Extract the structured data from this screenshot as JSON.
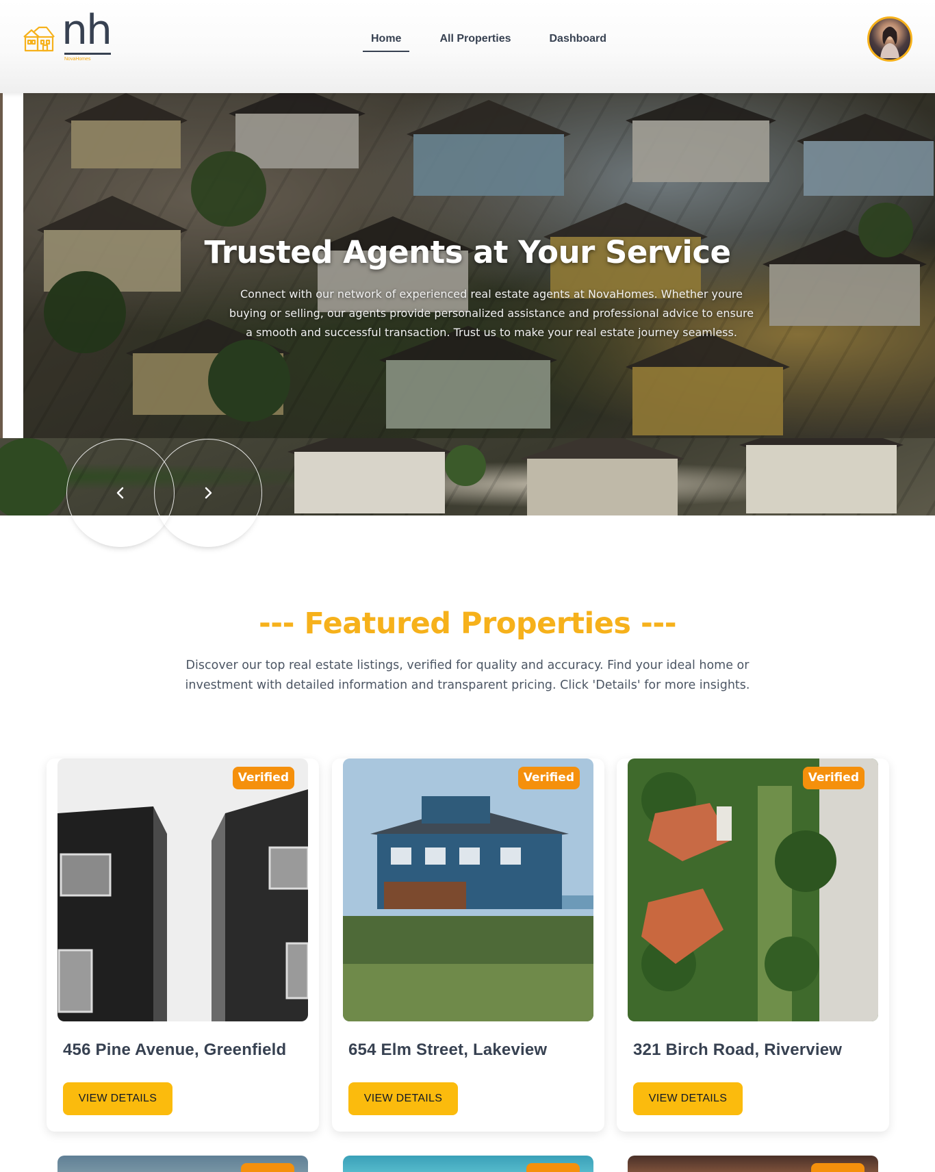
{
  "brand": {
    "logo_text": "nh",
    "logo_subtitle": "NovaHomes"
  },
  "nav": {
    "items": [
      {
        "label": "Home",
        "active": true
      },
      {
        "label": "All Properties",
        "active": false
      },
      {
        "label": "Dashboard",
        "active": false
      }
    ]
  },
  "user": {
    "avatar_icon": "user-avatar"
  },
  "hero": {
    "title": "Trusted Agents at Your Service",
    "description": "Connect with our network of experienced real estate agents at NovaHomes. Whether youre buying or selling, our agents provide personalized assistance and professional advice to ensure a smooth and successful transaction. Trust us to make your real estate journey seamless.",
    "prev_icon": "chevron-left-icon",
    "next_icon": "chevron-right-icon"
  },
  "featured": {
    "title": "--- Featured Properties ---",
    "description": "Discover our top real estate listings, verified for quality and accuracy. Find your ideal home or investment with detailed information and transparent pricing. Click 'Details' for more insights.",
    "cards": [
      {
        "badge": "Verified",
        "address": "456 Pine Avenue, Greenfield",
        "button": "VIEW DETAILS"
      },
      {
        "badge": "Verified",
        "address": "654 Elm Street, Lakeview",
        "button": "VIEW DETAILS"
      },
      {
        "badge": "Verified",
        "address": "321 Birch Road, Riverview",
        "button": "VIEW DETAILS"
      }
    ]
  },
  "colors": {
    "accent": "#f6b11b",
    "badge": "#f5900c",
    "button": "#fbbb0d",
    "text_dark": "#374151"
  }
}
